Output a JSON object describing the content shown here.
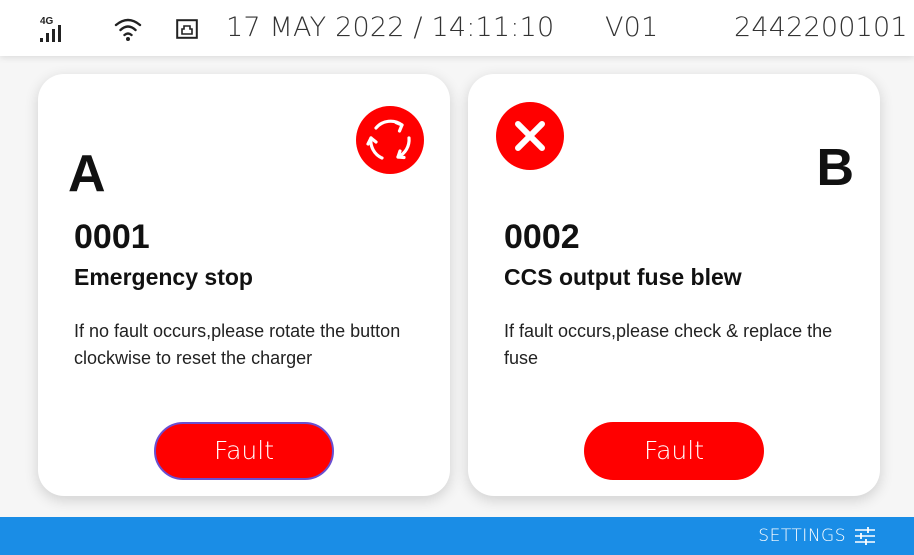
{
  "status_bar": {
    "network_label": "4G",
    "datetime": "17 MAY 2022 / 14:11:10",
    "version": "V01",
    "serial": "2442200101"
  },
  "connectors": [
    {
      "letter": "A",
      "status_icon": "emergency-stop-reset-icon",
      "code": "0001",
      "title": "Emergency stop",
      "description": "If no fault occurs,please rotate the button clockwise to reset the charger",
      "button_label": "Fault"
    },
    {
      "letter": "B",
      "status_icon": "error-x-icon",
      "code": "0002",
      "title": "CCS output fuse blew",
      "description": "If fault occurs,please check & replace the fuse",
      "button_label": "Fault"
    }
  ],
  "bottom_bar": {
    "settings_label": "SETTINGS"
  },
  "colors": {
    "fault_red": "#ff0000",
    "bottom_bar_blue": "#1a8de6",
    "card_bg": "#ffffff"
  }
}
